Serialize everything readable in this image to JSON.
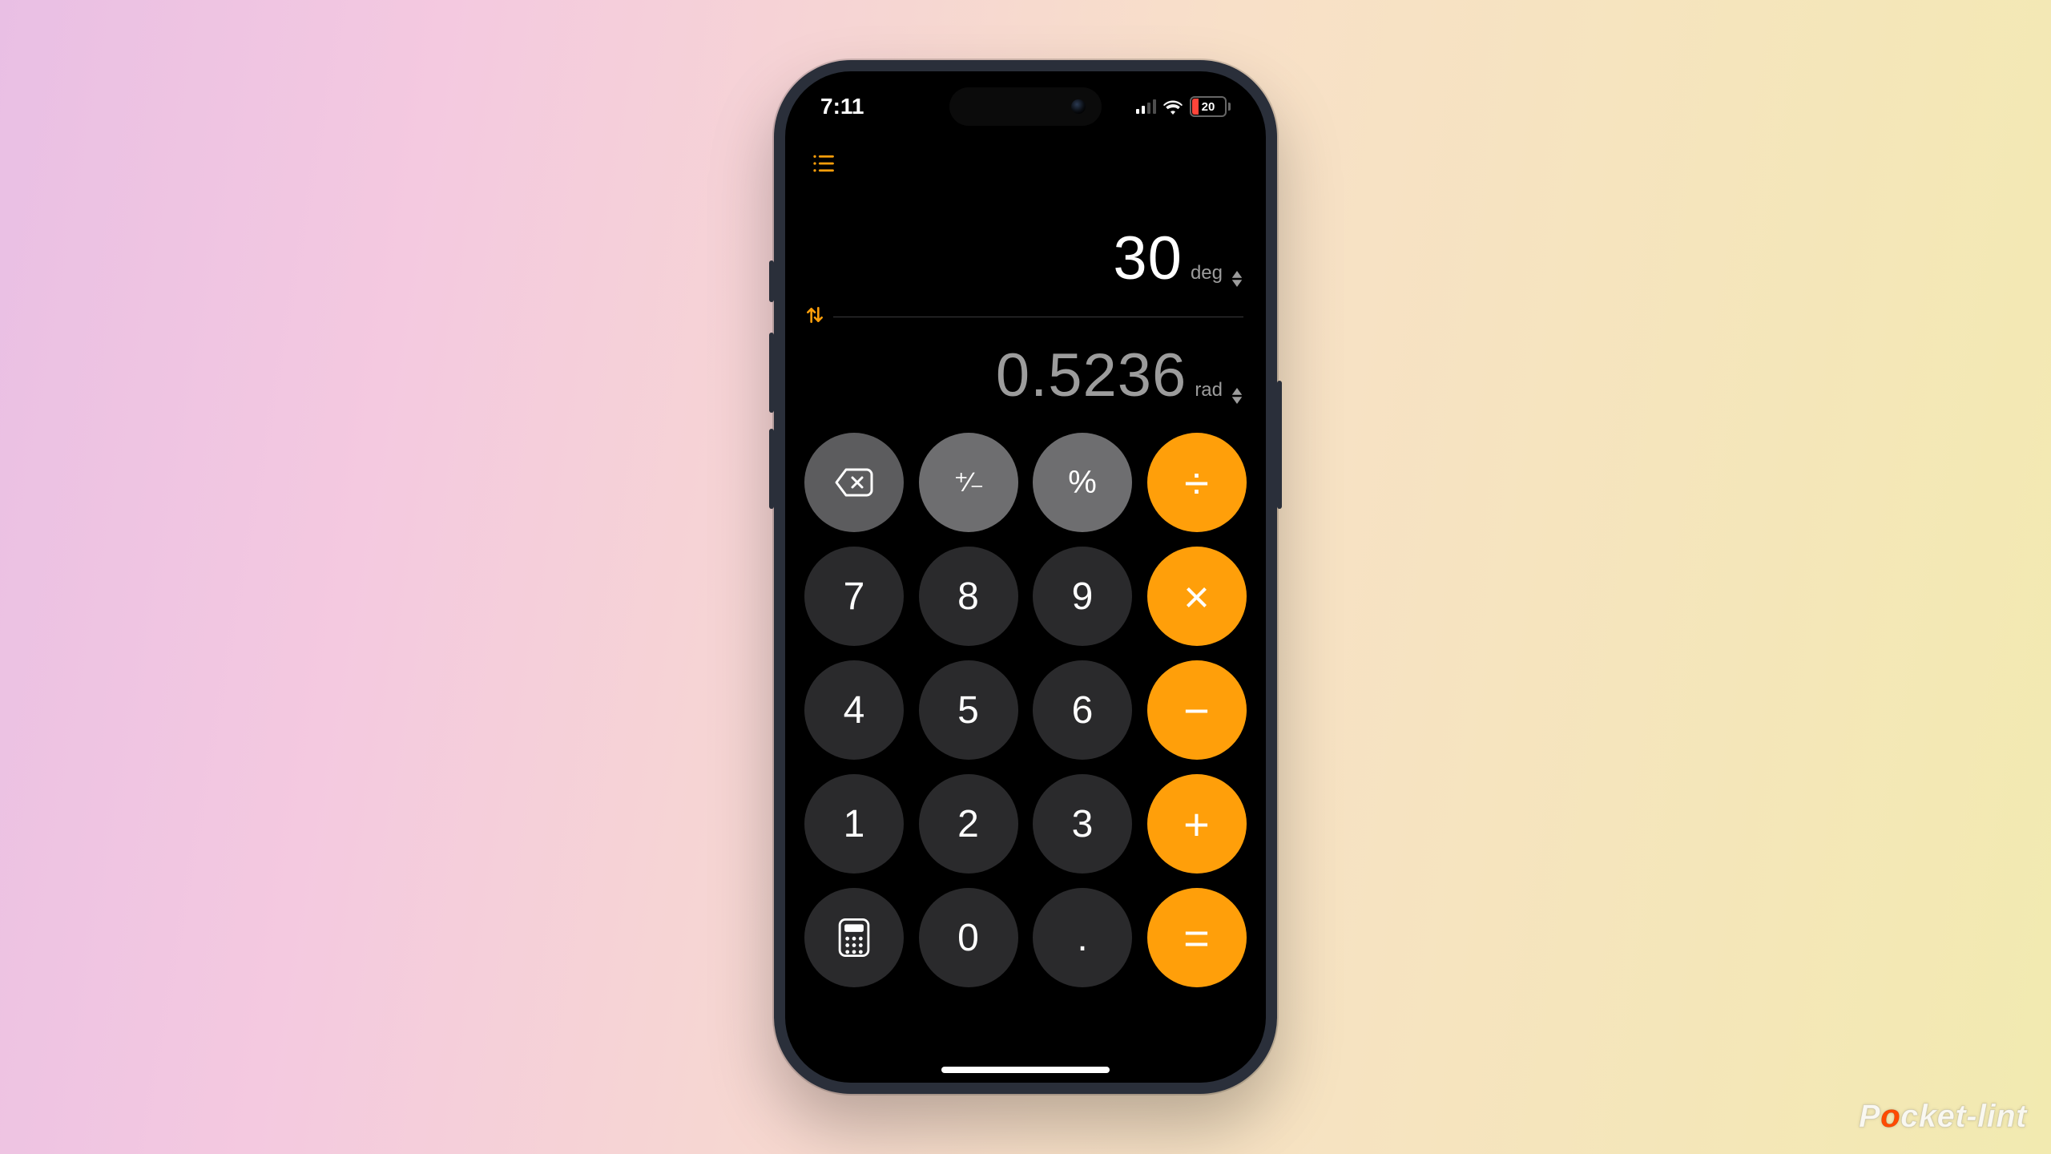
{
  "status_bar": {
    "time": "7:11",
    "battery": "20"
  },
  "display": {
    "primary_value": "30",
    "primary_unit": "deg",
    "secondary_value": "0.5236",
    "secondary_unit": "rad"
  },
  "keys": {
    "plus_minus": "+/_",
    "percent": "%",
    "divide": "÷",
    "multiply": "×",
    "minus": "−",
    "plus": "+",
    "equals": "=",
    "n7": "7",
    "n8": "8",
    "n9": "9",
    "n4": "4",
    "n5": "5",
    "n6": "6",
    "n1": "1",
    "n2": "2",
    "n3": "3",
    "n0": "0",
    "decimal": "."
  },
  "watermark": {
    "pre": "P",
    "o": "o",
    "post": "cket-lint"
  }
}
